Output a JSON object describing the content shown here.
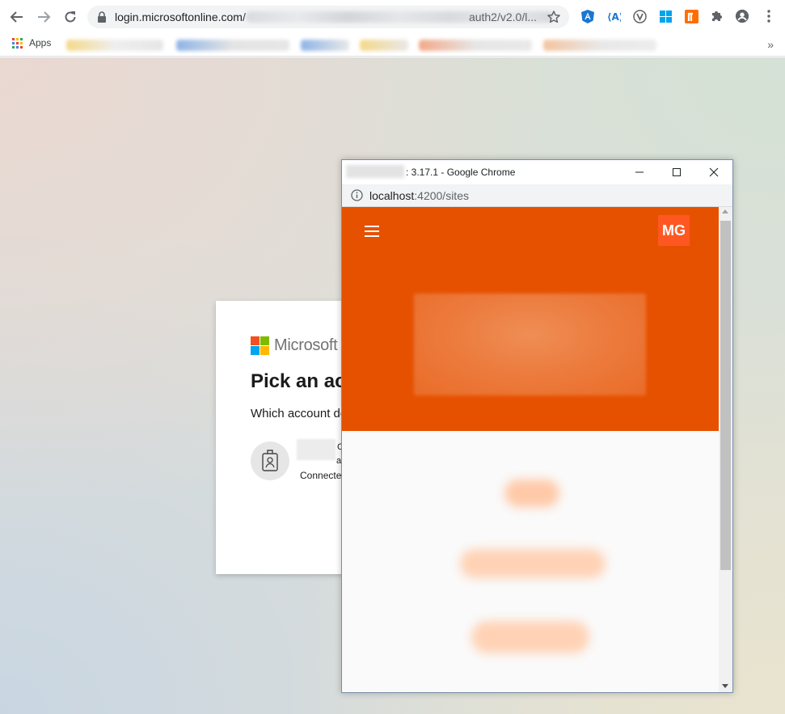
{
  "browser": {
    "url_host": "login.microsoftonline.com/",
    "url_tail": "auth2/v2.0/l...",
    "bookmarks": {
      "apps_label": "Apps",
      "more": "»"
    },
    "extension_icons": [
      "angular-icon",
      "azure-icon",
      "vue-icon",
      "windows-icon",
      "r-icon",
      "puzzle-icon",
      "profile-icon",
      "menu-dots-icon"
    ]
  },
  "ms_signin": {
    "brand": "Microsoft",
    "title": "Pick an account",
    "subtitle": "Which account do you want to use?",
    "account_line1": "C",
    "account_line2": "as",
    "account_status": "Connected to Windows"
  },
  "popup": {
    "title_suffix": ": 3.17.1 - Google Chrome",
    "url_host": "localhost",
    "url_path": ":4200/sites",
    "app": {
      "avatar_initials": "MG",
      "header_color": "#e65100",
      "badge_color": "#ff5722"
    }
  }
}
